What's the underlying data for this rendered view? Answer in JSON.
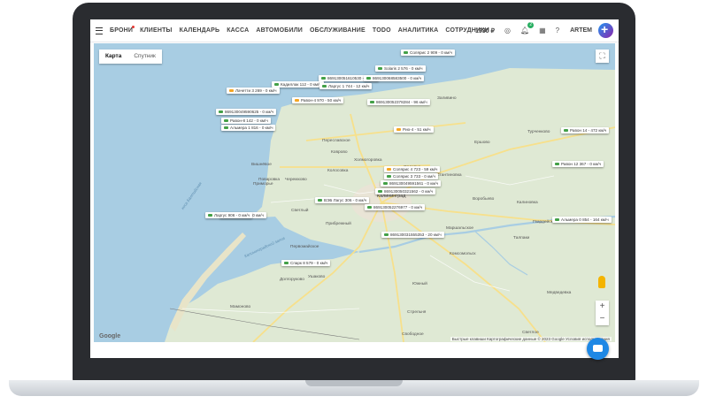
{
  "nav": {
    "items": [
      "БРОНИ",
      "КЛИЕНТЫ",
      "КАЛЕНДАРЬ",
      "КАССА",
      "АВТОМОБИЛИ",
      "ОБСЛУЖИВАНИЕ",
      "TODO",
      "АНАЛИТИКА",
      "СОТРУДНИКИ"
    ]
  },
  "header": {
    "balance": "1930 ₽",
    "notification_count": "2",
    "user": "ARTEM"
  },
  "map": {
    "type_buttons": {
      "map": "Карта",
      "satellite": "Спутник"
    },
    "zoom_in": "+",
    "zoom_out": "−",
    "google": "Google",
    "attribution": "Быстрые клавиши   Картографические данные © 2023 Google   Условия использования",
    "places": [
      "Зеленоградск",
      "Переславское",
      "Коврово",
      "Колосовка",
      "Холмогоровка",
      "Орловка",
      "Гурьевск",
      "Константиновка",
      "Ушаково",
      "Рыбное",
      "Вишнёвое",
      "Приморье",
      "Поваровка",
      "Черемхово",
      "Прибрежный",
      "Светлый",
      "Калининград",
      "Ладушкин",
      "Ушаково",
      "Мамоново",
      "Крестовые",
      "Южный",
      "Стрельня",
      "Комсомольск",
      "Маршальское",
      "Воробьево",
      "Гвардейск",
      "Талпаки",
      "Калиновка",
      "Ершово",
      "Турченково",
      "Гурьевск",
      "Большое Исаково",
      "Кадыжино",
      "Первомайское",
      "Долгоруково",
      "Свободное",
      "Медведевка",
      "Светлое",
      "Заливино"
    ],
    "water_labels": [
      "Балтийск",
      "Калининградский залив",
      "коса Балтийская"
    ],
    "cars": [
      "Солярис 2 909 - 0 км/ч",
      "Solaris 2 576 - 0 км/ч",
      "869130051610530 - 0 км/ч",
      "869130068583500 - 0 км/ч",
      "Кадиллак 112 - 0 км/ч",
      "Ларгус 1 744 - 12 км/ч",
      "Лачетти 3 269 - 0 км/ч",
      "869130052378284 - 96 км/ч",
      "Равон-4 970 - 50 км/ч",
      "869130049590625 - 0 км/ч",
      "Равон-8 142 - 0 км/ч",
      "Альмера 1 816 - 0 км/ч",
      "Рио-4 - 51 км/ч",
      "Равон 14 - 472 км/ч",
      "Равон 12 367 - 0 км/ч",
      "Солярис 4 723 - 59 км/ч",
      "Солярис 3 733 - 0 км/ч",
      "869130049591561 - 0 км/ч",
      "869130050321562 - 0 км/ч",
      "ВЭБ Лагус 306 - 0 км/ч",
      "869130052276977 - 0 км/ч",
      "Тигуан 780 - 0 км/ч",
      "Ларгус 906 - 0 км/ч",
      "869130031555353 - 20 км/ч",
      "Альмера 0 854 - 164 км/ч",
      "Спарк 8 579 - 0 км/ч"
    ]
  },
  "colors": {
    "land": "#dfe9d4",
    "water": "#a8cde3",
    "road": "#f7e08b",
    "accent": "#1e88e5"
  }
}
